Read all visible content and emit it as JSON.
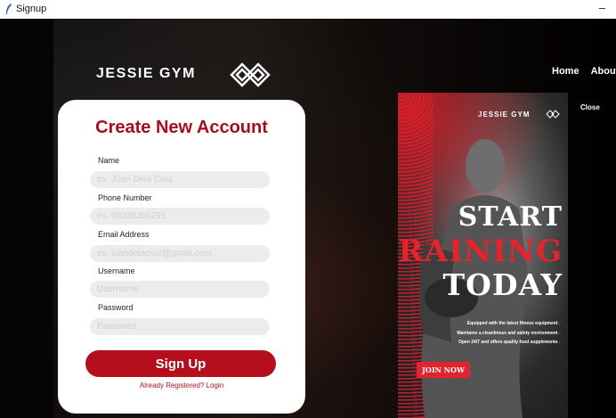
{
  "window": {
    "title": "Signup",
    "minimize": "–"
  },
  "header": {
    "logo": "JESSIE GYM",
    "nav": [
      "Home",
      "About"
    ]
  },
  "promo": {
    "logo": "JESSIE GYM",
    "close": "Close",
    "headline": [
      "START",
      "TRAINING",
      "TODAY"
    ],
    "bullets": [
      "Equipped with the latest fitness equipment",
      "Maintains a cleanliness and safety environment",
      "Open 24/7 and offers quality food supplements"
    ],
    "cta": "JOIN NOW",
    "accent": "#e3232e"
  },
  "form": {
    "title": "Create New Account",
    "fields": [
      {
        "label": "Name",
        "placeholder": "ex: Juan Dela Cruz"
      },
      {
        "label": "Phone Number",
        "placeholder": "ex: 09235356291"
      },
      {
        "label": "Email Address",
        "placeholder": "ex: juandelacruz@gmail.com"
      },
      {
        "label": "Username",
        "placeholder": "Username"
      },
      {
        "label": "Password",
        "placeholder": "Password"
      }
    ],
    "submit": "Sign Up",
    "login_link": "Already Registered? Login",
    "accent": "#b50f1e"
  }
}
